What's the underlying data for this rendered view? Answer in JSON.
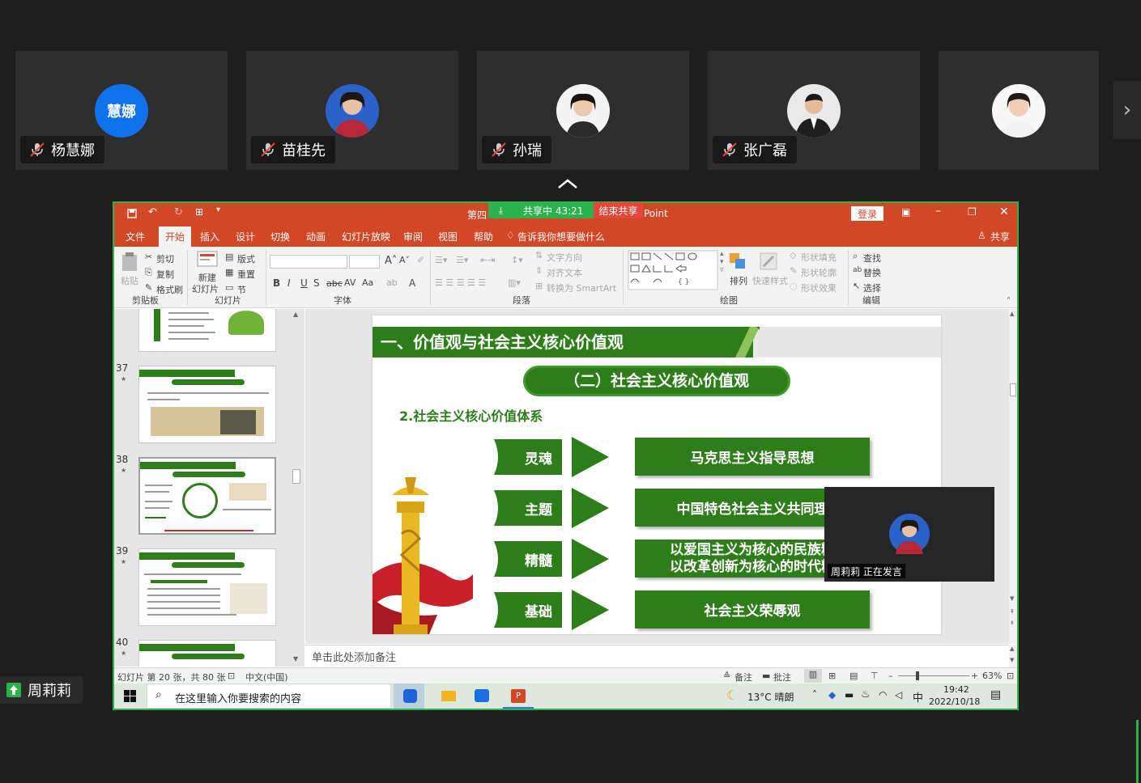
{
  "participants": [
    {
      "name": "杨慧娜",
      "avatar_text": "慧娜"
    },
    {
      "name": "苗桂先"
    },
    {
      "name": "孙瑞"
    },
    {
      "name": "张广磊"
    },
    {
      "name": ""
    }
  ],
  "share_bar": {
    "status": "共享中 43:21",
    "end_label": "结束共享"
  },
  "self_name": "周莉莉",
  "ppt": {
    "title_left": "第四",
    "title_right": "Point",
    "login": "登录",
    "tabs": [
      "文件",
      "开始",
      "插入",
      "设计",
      "切换",
      "动画",
      "幻灯片放映",
      "审阅",
      "视图",
      "帮助"
    ],
    "tellme": "告诉我你想要做什么",
    "share": "共享",
    "ribbon": {
      "paste": "粘贴",
      "cut": "剪切",
      "copy": "复制",
      "format_painter": "格式刷",
      "clipboard_group": "剪贴板",
      "layout": "版式",
      "reset": "重置",
      "new_slide": "新建\n幻灯片",
      "new_slide_a": "新建",
      "new_slide_b": "幻灯片",
      "section": "节",
      "slides_group": "幻灯片",
      "font_group": "字体",
      "text_dir": "文字方向",
      "align_text": "对齐文本",
      "smartart": "转换为 SmartArt",
      "paragraph_group": "段落",
      "arrange": "排列",
      "quick_styles": "快速样式",
      "shape_fill": "形状填充",
      "shape_outline": "形状轮廓",
      "shape_effect": "形状效果",
      "drawing_group": "绘图",
      "find": "查找",
      "replace": "替换",
      "select": "选择",
      "editing_group": "编辑"
    },
    "thumbnails": [
      {
        "num": "37"
      },
      {
        "num": "38"
      },
      {
        "num": "39"
      },
      {
        "num": "40"
      }
    ],
    "slide": {
      "header": "一、价值观与社会主义核心价值观",
      "pill": "（二）社会主义核心价值观",
      "subheading": "2.社会主义核心价值体系",
      "rows": [
        {
          "left": "灵魂",
          "right": "马克思主义指导思想"
        },
        {
          "left": "主题",
          "right": "中国特色社会主义共同理"
        },
        {
          "left": "精髓",
          "right_line1": "以爱国主义为核心的民族精",
          "right_line2": "以改革创新为核心的时代精"
        },
        {
          "left": "基础",
          "right": "社会主义荣辱观"
        }
      ]
    },
    "notes_placeholder": "单击此处添加备注",
    "status": {
      "slide_info": "幻灯片 第 20 张，共 80 张",
      "language": "中文(中国)",
      "notes": "备注",
      "comments": "批注",
      "zoom": "63%"
    },
    "taskbar": {
      "search_placeholder": "在这里输入你要搜索的内容",
      "weather": "13°C 晴朗",
      "ime": "中",
      "time": "19:42",
      "date": "2022/10/18"
    }
  },
  "speaker": {
    "label": "周莉莉 正在发言"
  },
  "colors": {
    "accent_green": "#2e7d1a",
    "ppt_orange": "#d24726",
    "zoom_blue": "#0e72ed",
    "share_green": "#2bb24c"
  }
}
